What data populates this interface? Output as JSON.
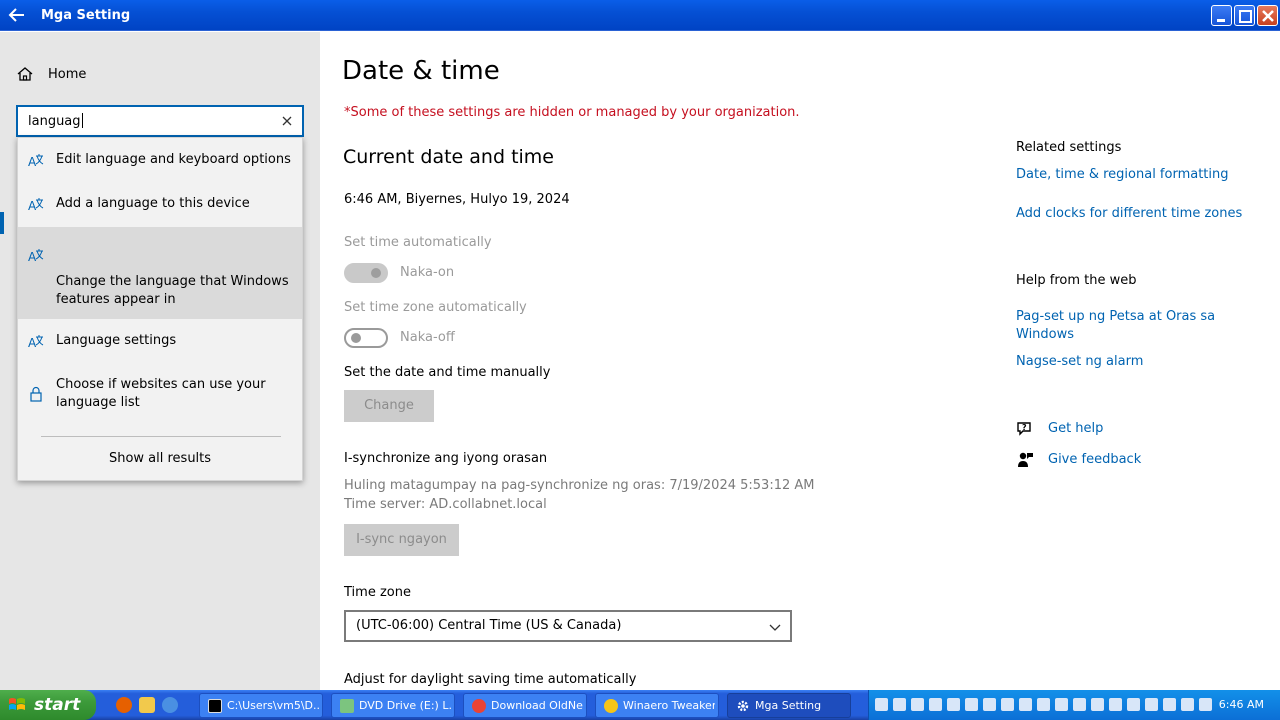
{
  "window": {
    "title": "Mga Setting"
  },
  "sidebar": {
    "home_label": "Home"
  },
  "search": {
    "value": "languag",
    "suggestions": [
      {
        "label": "Edit language and keyboard options",
        "icon": "language-icon"
      },
      {
        "label": "Add a language to this device",
        "icon": "language-icon"
      },
      {
        "label": "Change the language that Windows features appear in",
        "icon": "language-icon"
      },
      {
        "label": "Language settings",
        "icon": "language-icon"
      },
      {
        "label": "Choose if websites can use your language list",
        "icon": "lock-icon"
      }
    ],
    "show_all": "Show all results"
  },
  "main": {
    "title": "Date & time",
    "managed_warning": "*Some of these settings are hidden or managed by your organization.",
    "current_heading": "Current date and time",
    "current_value": "6:46 AM, Biyernes, Hulyo 19, 2024",
    "set_time_auto_label": "Set time automatically",
    "set_time_auto_state": "Naka-on",
    "set_tz_auto_label": "Set time zone automatically",
    "set_tz_auto_state": "Naka-off",
    "manual_label": "Set the date and time manually",
    "change_button": "Change",
    "sync_heading": "I-synchronize ang iyong orasan",
    "sync_last": "Huling matagumpay na pag-synchronize ng oras: 7/19/2024 5:53:12 AM",
    "sync_server": "Time server: AD.collabnet.local",
    "sync_button": "I-sync ngayon",
    "timezone_label": "Time zone",
    "timezone_value": "(UTC-06:00) Central Time (US & Canada)",
    "dst_label": "Adjust for daylight saving time automatically"
  },
  "related": {
    "heading": "Related settings",
    "links": [
      "Date, time & regional formatting",
      "Add clocks for different time zones"
    ]
  },
  "help": {
    "heading": "Help from the web",
    "links": [
      "Pag-set up ng Petsa at Oras sa Windows",
      "Nagse-set ng alarm"
    ],
    "get_help": "Get help",
    "feedback": "Give feedback"
  },
  "taskbar": {
    "start_label": "start",
    "buttons": [
      {
        "label": "C:\\Users\\vm5\\D...",
        "icon": "cmd-icon"
      },
      {
        "label": "DVD Drive (E:) L...",
        "icon": "dvd-icon"
      },
      {
        "label": "Download OldNe...",
        "icon": "chrome-icon"
      },
      {
        "label": "Winaero Tweaker",
        "icon": "winaero-icon"
      },
      {
        "label": "Mga Setting",
        "icon": "gear-icon"
      }
    ],
    "clock": "6:46 AM"
  },
  "colors": {
    "accent": "#0063b1",
    "warning": "#c50f1f",
    "titlebar": "#0550d4",
    "taskbar": "#245edb",
    "start": "#3c9a3a"
  }
}
